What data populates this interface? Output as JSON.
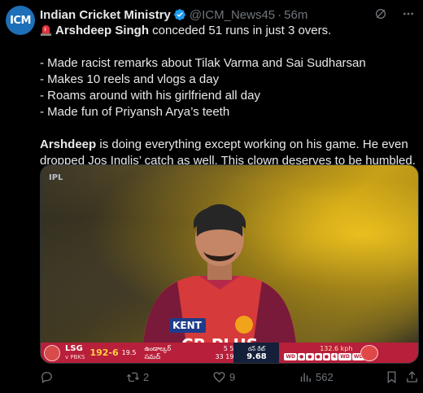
{
  "avatar": {
    "text": "ICM",
    "color": "#1d6fb8"
  },
  "header": {
    "name": "Indian Cricket Ministry",
    "handle": "@ICM_News45",
    "separator": "·",
    "time": "56m",
    "verified_color": "#1d9bf0"
  },
  "top_icons": [
    "grok-icon",
    "more-icon"
  ],
  "body": {
    "line1_name": "Arshdeep Singh",
    "line1_rest": " conceded 51 runs in just 3 overs.",
    "bullets": [
      "- Made racist remarks about Tilak Varma and Sai Sudharsan",
      "- Makes 10 reels and vlogs a day",
      "- Roams around with his girlfriend all day",
      "- Made fun of Priyansh Arya’s teeth"
    ],
    "para_name": "Arshdeep",
    "para_rest": " is doing everything except working on his game. He even dropped Jos Inglis’ catch as well. This clown deserves to be humbled."
  },
  "media": {
    "watermark": "IPL",
    "jersey_sponsor": "KENT",
    "jersey_text": "CB PLUS",
    "scoreboard": {
      "team": "LSG",
      "vs": "v PBKS",
      "score": "192-6",
      "overs": "19.5",
      "bat1_name": "ఉండాల్కర్",
      "bat1_score": "5",
      "bat1_balls": "5",
      "bat2_name": "సమద్",
      "bat2_score": "33",
      "bat2_balls": "19",
      "rr_label": "రన్ రేట్",
      "rr_value": "9.68",
      "speed": "132.6 kph",
      "balls": [
        "WD",
        "●",
        "●",
        "●",
        "●",
        "4",
        "WD",
        "WD"
      ]
    }
  },
  "actions": {
    "reply": "",
    "retweet": "2",
    "like": "9",
    "views": "562"
  }
}
